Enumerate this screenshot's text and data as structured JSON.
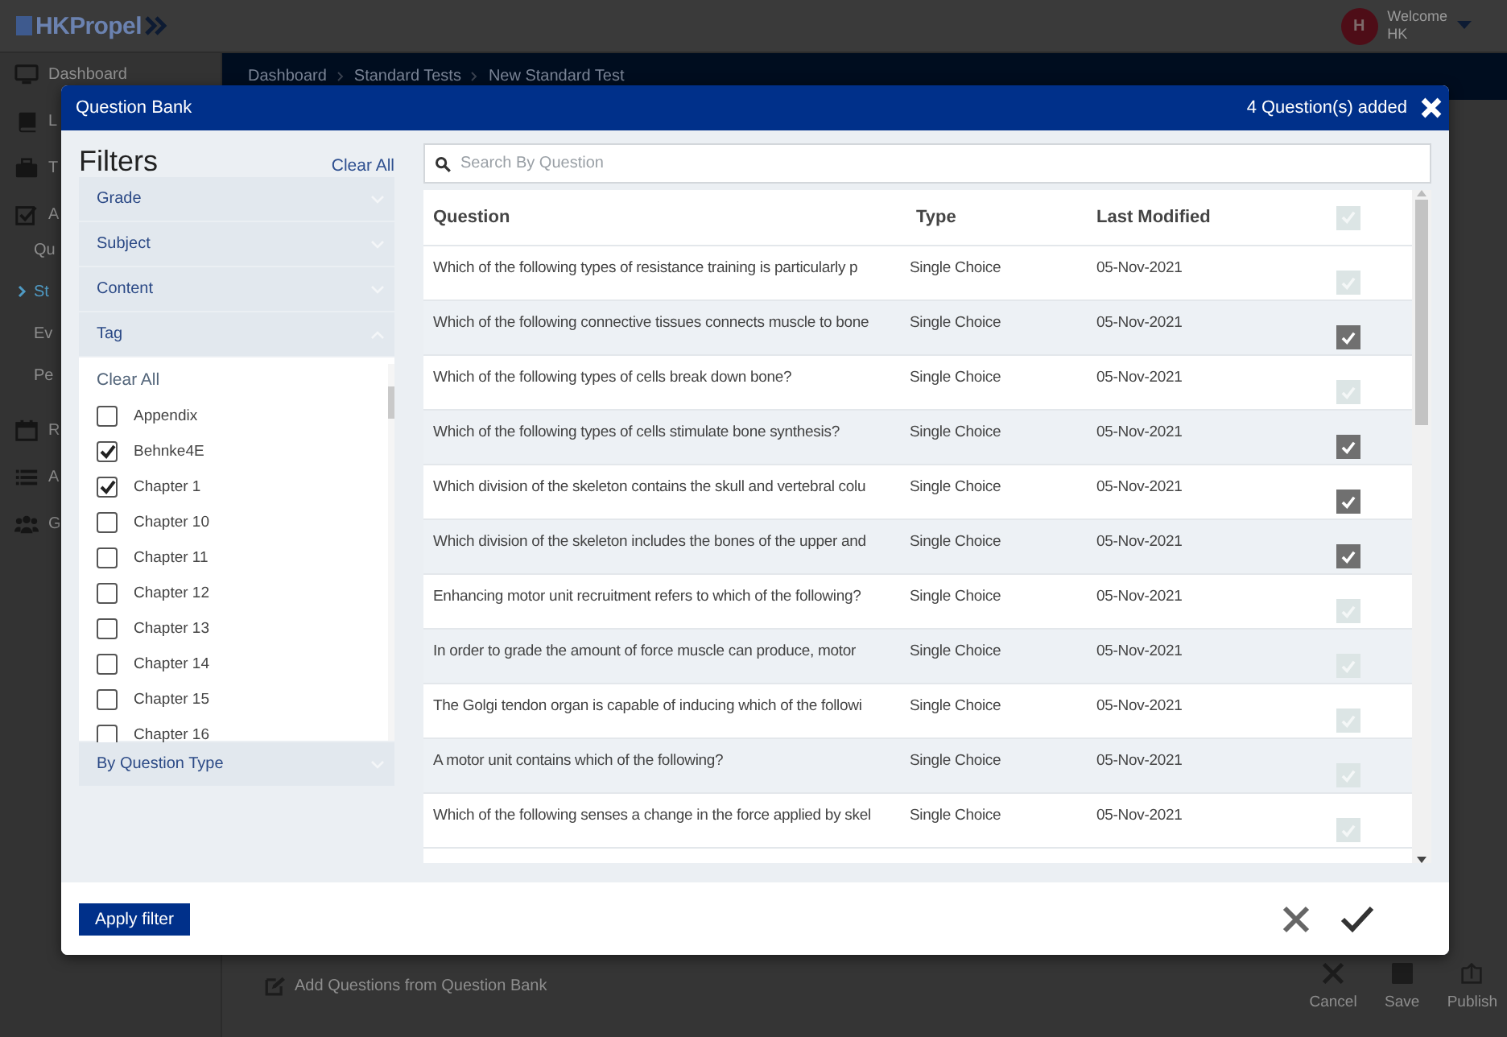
{
  "app": {
    "logo": "HKPropel",
    "user": {
      "initial": "H",
      "greeting": "Welcome",
      "name": "HK"
    },
    "sidebar": [
      {
        "label": "Dashboard"
      },
      {
        "label": "L"
      },
      {
        "label": "T"
      },
      {
        "label": "A",
        "children": [
          {
            "label": "Qu",
            "selected": false
          },
          {
            "label": "St",
            "selected": true
          },
          {
            "label": "Ev",
            "selected": false
          },
          {
            "label": "Pe",
            "selected": false
          }
        ]
      },
      {
        "label": "R"
      },
      {
        "label": "A"
      },
      {
        "label": "G"
      }
    ],
    "breadcrumb": [
      "Dashboard",
      "Standard Tests",
      "New Standard Test"
    ],
    "add_link": "Add Questions from Question Bank",
    "actions": [
      "Cancel",
      "Save",
      "Publish"
    ]
  },
  "modal": {
    "title": "Question Bank",
    "added": "4 Question(s) added",
    "filters": {
      "title": "Filters",
      "clear_all": "Clear All",
      "groups": [
        {
          "label": "Grade",
          "expanded": false
        },
        {
          "label": "Subject",
          "expanded": false
        },
        {
          "label": "Content",
          "expanded": false
        },
        {
          "label": "Tag",
          "expanded": true,
          "clear_all": "Clear All",
          "options": [
            {
              "label": "Appendix",
              "checked": false
            },
            {
              "label": "Behnke4E",
              "checked": true
            },
            {
              "label": "Chapter 1",
              "checked": true
            },
            {
              "label": "Chapter 10",
              "checked": false
            },
            {
              "label": "Chapter 11",
              "checked": false
            },
            {
              "label": "Chapter 12",
              "checked": false
            },
            {
              "label": "Chapter 13",
              "checked": false
            },
            {
              "label": "Chapter 14",
              "checked": false
            },
            {
              "label": "Chapter 15",
              "checked": false
            },
            {
              "label": "Chapter 16",
              "checked": false
            }
          ]
        },
        {
          "label": "By Question Type",
          "expanded": false
        }
      ]
    },
    "search": {
      "placeholder": "Search By Question"
    },
    "table": {
      "columns": [
        "Question",
        "Type",
        "Last Modified"
      ],
      "all_selected": false,
      "rows": [
        {
          "question": "Which of the following types of resistance training is particularly p",
          "type": "Single Choice",
          "modified": "05-Nov-2021",
          "selected": false
        },
        {
          "question": "Which of the following connective tissues connects muscle to bone",
          "type": "Single Choice",
          "modified": "05-Nov-2021",
          "selected": true
        },
        {
          "question": "Which of the following types of cells break down bone?",
          "type": "Single Choice",
          "modified": "05-Nov-2021",
          "selected": false
        },
        {
          "question": "Which of the following types of cells stimulate bone synthesis?",
          "type": "Single Choice",
          "modified": "05-Nov-2021",
          "selected": true
        },
        {
          "question": "Which division of the skeleton contains the skull and vertebral colu",
          "type": "Single Choice",
          "modified": "05-Nov-2021",
          "selected": true
        },
        {
          "question": "Which division of the skeleton includes the bones of the upper and",
          "type": "Single Choice",
          "modified": "05-Nov-2021",
          "selected": true
        },
        {
          "question": "Enhancing motor unit recruitment refers to which of the following?",
          "type": "Single Choice",
          "modified": "05-Nov-2021",
          "selected": false
        },
        {
          "question": "In order to grade the amount of force muscle can produce, motor",
          "type": "Single Choice",
          "modified": "05-Nov-2021",
          "selected": false
        },
        {
          "question": "The Golgi tendon organ is capable of inducing which of the followi",
          "type": "Single Choice",
          "modified": "05-Nov-2021",
          "selected": false
        },
        {
          "question": "A motor unit contains which of the following?",
          "type": "Single Choice",
          "modified": "05-Nov-2021",
          "selected": false
        },
        {
          "question": "Which of the following senses a change in the force applied by skel",
          "type": "Single Choice",
          "modified": "05-Nov-2021",
          "selected": false
        }
      ]
    },
    "apply": "Apply filter"
  }
}
